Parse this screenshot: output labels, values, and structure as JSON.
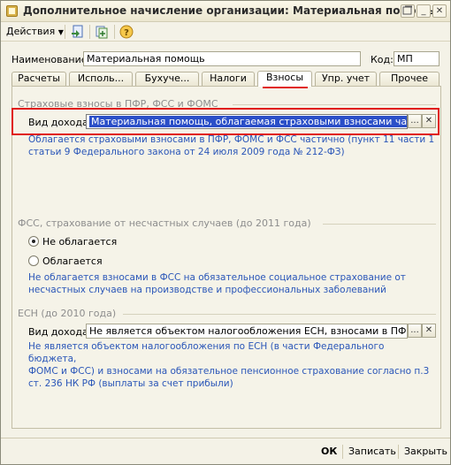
{
  "window": {
    "title": "Дополнительное начисление организации: Материальная помощь"
  },
  "toolbar": {
    "actions_label": "Действия",
    "help_label": "?"
  },
  "header": {
    "name_label": "Наименование:",
    "name_value": "Материальная помощь",
    "code_label": "Код:",
    "code_value": "МП"
  },
  "tabs": [
    {
      "label": "Расчеты"
    },
    {
      "label": "Исполь..."
    },
    {
      "label": "Бухуче..."
    },
    {
      "label": "Налоги"
    },
    {
      "label": "Взносы"
    },
    {
      "label": "Упр. учет"
    },
    {
      "label": "Прочее"
    }
  ],
  "active_tab": "Взносы",
  "insurance": {
    "title": "Страховые взносы в ПФР, ФСС и ФОМС",
    "income_label": "Вид дохода:",
    "income_value": "Материальная помощь, облагаемая страховыми взносами частично",
    "info_line1": "Облагается страховыми взносами в ПФР, ФОМС и ФСС частично (пункт 11 части 1",
    "info_line2": "статьи 9 Федерального закона от 24 июля 2009 года № 212-ФЗ)"
  },
  "fss": {
    "title": "ФСС, страхование от несчастных случаев (до 2011 года)",
    "option_not_taxed": "Не облагается",
    "option_taxed": "Облагается",
    "selected": "Не облагается",
    "info_line1": "Не облагается взносами в ФСС на обязательное социальное страхование от",
    "info_line2": "несчастных случаев на производстве и профессиональных заболеваний"
  },
  "esn": {
    "title": "ЕСН (до 2010 года)",
    "income_label": "Вид дохода:",
    "income_value": "Не является объектом налогообложения ЕСН, взносами в ПФР согла",
    "info_line1": "Не является объектом налогообложения по ЕСН (в части Федерального бюджета,",
    "info_line2": "ФОМС и ФСС) и взносами на обязательное пенсионное страхование согласно п.3",
    "info_line3": "ст. 236 НК РФ (выплаты за счет прибыли)"
  },
  "footer": {
    "ok_label": "ОК",
    "save_label": "Записать",
    "close_label": "Закрыть"
  }
}
